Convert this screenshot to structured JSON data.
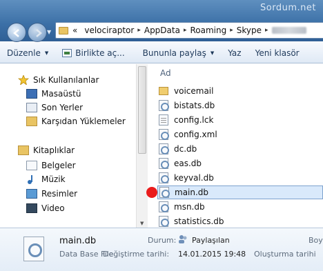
{
  "watermark": "Sordum.net",
  "address": {
    "overflow": "«",
    "crumbs": [
      "velociraptor",
      "AppData",
      "Roaming",
      "Skype"
    ]
  },
  "toolbar": {
    "organize": "Düzenle",
    "include": "Birlikte aç...",
    "share": "Bununla paylaş",
    "print": "Yaz",
    "new_folder": "Yeni klasör"
  },
  "nav": {
    "favorites_header": "Sık Kullanılanlar",
    "favorites": [
      "Masaüstü",
      "Son Yerler",
      "Karşıdan Yüklemeler"
    ],
    "libraries_header": "Kitaplıklar",
    "libraries": [
      "Belgeler",
      "Müzik",
      "Resimler",
      "Video"
    ]
  },
  "files": {
    "column_header": "Ad",
    "items": [
      {
        "name": "voicemail",
        "icon": "folder-icon"
      },
      {
        "name": "bistats.db",
        "icon": "db-file-icon"
      },
      {
        "name": "config.lck",
        "icon": "text-file-icon"
      },
      {
        "name": "config.xml",
        "icon": "db-file-icon"
      },
      {
        "name": "dc.db",
        "icon": "db-file-icon"
      },
      {
        "name": "eas.db",
        "icon": "db-file-icon"
      },
      {
        "name": "keyval.db",
        "icon": "db-file-icon"
      },
      {
        "name": "main.db",
        "icon": "db-file-icon"
      },
      {
        "name": "msn.db",
        "icon": "db-file-icon"
      },
      {
        "name": "statistics.db",
        "icon": "db-file-icon"
      }
    ],
    "selected": "main.db"
  },
  "details": {
    "filename": "main.db",
    "filetype": "Data Base File",
    "state_label": "Durum:",
    "state_value": "Paylaşılan",
    "modified_label": "Değiştirme tarihi:",
    "modified_value": "14.01.2015 19:48",
    "size_label": "Boy",
    "created_label": "Oluşturma tarihi"
  },
  "colors": {
    "titlebar": "#3b6fa6",
    "selection": "#d9e9fb",
    "marker": "#ea1c1c"
  }
}
